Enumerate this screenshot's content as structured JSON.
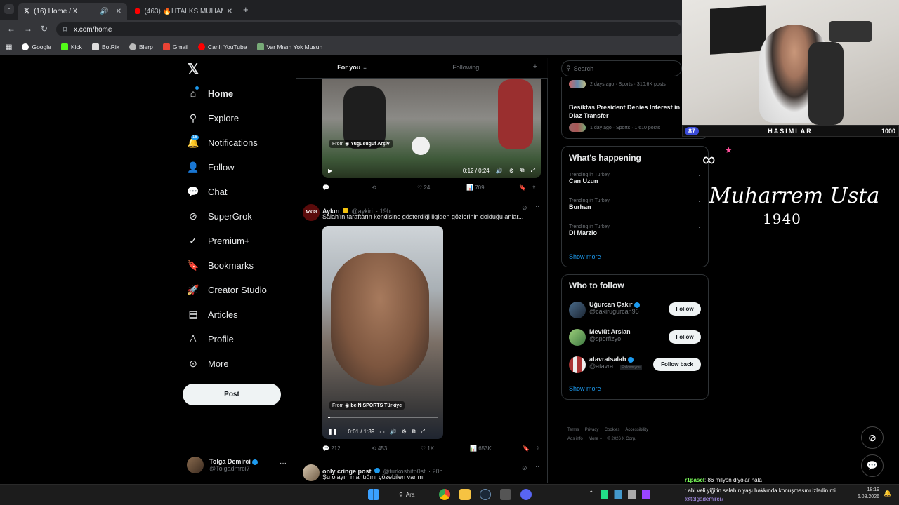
{
  "browser": {
    "tabs": [
      {
        "label": "(16) Home / X",
        "active": true
      },
      {
        "label": "(463) 🔥HTALKS MUHAMMED…",
        "active": false
      }
    ],
    "url": "x.com/home",
    "bookmarks": [
      "Google",
      "Kick",
      "BotRix",
      "Blerp",
      "Gmail",
      "Canlı YouTube",
      "Var Mısın Yok Musun"
    ]
  },
  "sidebar": {
    "items": [
      {
        "label": "Home",
        "icon": "home-icon"
      },
      {
        "label": "Explore",
        "icon": "search-icon"
      },
      {
        "label": "Notifications",
        "icon": "bell-icon",
        "badge": "16"
      },
      {
        "label": "Follow",
        "icon": "person-add-icon"
      },
      {
        "label": "Chat",
        "icon": "chat-icon"
      },
      {
        "label": "SuperGrok",
        "icon": "grok-icon"
      },
      {
        "label": "Premium+",
        "icon": "verified-icon"
      },
      {
        "label": "Bookmarks",
        "icon": "bookmark-icon"
      },
      {
        "label": "Creator Studio",
        "icon": "rocket-icon"
      },
      {
        "label": "Articles",
        "icon": "article-icon"
      },
      {
        "label": "Profile",
        "icon": "profile-icon"
      },
      {
        "label": "More",
        "icon": "more-icon"
      }
    ],
    "post_label": "Post",
    "account": {
      "name": "Tolga Demirci",
      "handle": "@Tolgadmrci7",
      "more": "···"
    }
  },
  "feed": {
    "tabs": [
      "For you",
      "Following"
    ],
    "add": "+",
    "tweet1": {
      "video_from": "From",
      "video_source": "Yugusuguf Arşiv",
      "time": "0:12 / 0:24",
      "replies": "",
      "retweets": "",
      "likes": "24",
      "views": "709"
    },
    "tweet2": {
      "name": "Aykırı",
      "handle": "@aykiri",
      "age": "· 19h",
      "avatar_text": "AYKIRI",
      "text": "Salah'ın taraftarın kendisine gösterdiği ilgiden gözlerinin dolduğu anlar...",
      "video_from": "From",
      "video_source": "beIN SPORTS Türkiye",
      "time": "0:01 / 1:39",
      "replies": "212",
      "retweets": "453",
      "likes": "1K",
      "views": "653K"
    },
    "tweet3": {
      "name": "only cringe post",
      "handle": "@turkoshitp0st",
      "age": "· 20h",
      "text": "Şu olayın mantığını çözebilen var mı"
    }
  },
  "right": {
    "search_placeholder": "Search",
    "top_card": {
      "meta1": "2 days ago · Sports · 310.6K posts",
      "title2": "Besiktas President Denies Interest in Brahim Diaz Transfer",
      "meta2": "1 day ago · Sports · 1,610 posts"
    },
    "happening": {
      "title": "What's happening",
      "trends": [
        {
          "meta": "Trending in Turkey",
          "name": "Can Uzun"
        },
        {
          "meta": "Trending in Turkey",
          "name": "Burhan"
        },
        {
          "meta": "Trending in Turkey",
          "name": "Di Marzio"
        }
      ],
      "show_more": "Show more"
    },
    "who_to_follow": {
      "title": "Who to follow",
      "users": [
        {
          "name": "Uğurcan Çakır",
          "handle": "@cakirugurcan96",
          "button": "Follow"
        },
        {
          "name": "Mevlüt Arslan",
          "handle": "@sporfizyo",
          "button": "Follow"
        },
        {
          "name": "atavratsalah",
          "handle": "@atavra...",
          "follows_you": "Follows you",
          "button": "Follow back"
        }
      ],
      "show_more": "Show more"
    },
    "footer": [
      "Terms",
      "Privacy",
      "Cookies",
      "Accessibility",
      "Ads info",
      "More ···",
      "© 2026 X Corp."
    ]
  },
  "stream": {
    "bar_left": "87",
    "bar_title": "HASIMLAR",
    "bar_right": "1000",
    "logo_line1": "Muharrem Usta",
    "logo_line2": "1940",
    "chat": [
      {
        "user": "r1pascl",
        "text": ": 86 milyon diyolar hala"
      },
      {
        "user": "",
        "text": ": abi veli yiğitin salahın yaşı hakkında konuşmasını izledin mi"
      },
      {
        "user": "@tolgademirci7",
        "text": ""
      }
    ]
  },
  "taskbar": {
    "search": "Ara",
    "time": "18:19",
    "date": "6.08.2026"
  },
  "colors": {
    "accent": "#1d9bf0",
    "bg": "#000000",
    "border": "#2f3336",
    "gold": "#f4c20d"
  }
}
